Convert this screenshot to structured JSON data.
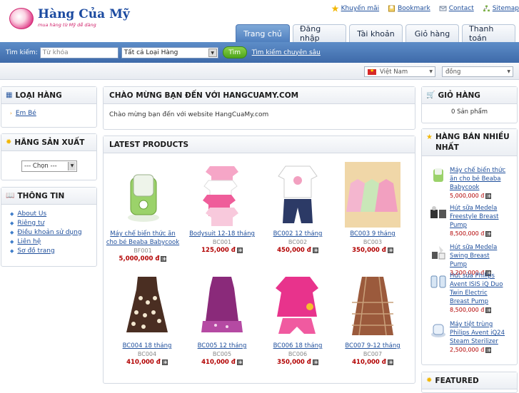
{
  "header": {
    "logo_title": "Hàng Của Mỹ",
    "logo_slogan": "mua hàng từ Mỹ dễ dàng",
    "top_links": [
      {
        "label": "Khuyến mãi",
        "icon": "star-icon"
      },
      {
        "label": "Bookmark",
        "icon": "bookmark-icon"
      },
      {
        "label": "Contact",
        "icon": "mail-icon"
      },
      {
        "label": "Sitemap",
        "icon": "sitemap-icon"
      }
    ],
    "tabs": [
      "Trang chủ",
      "Đăng nhập",
      "Tài khoản",
      "Giỏ hàng",
      "Thanh toán"
    ],
    "active_tab": "Trang chủ"
  },
  "search": {
    "label": "Tìm kiếm:",
    "placeholder": "Từ khóa",
    "category": "Tất cả Loại Hàng",
    "button": "Tìm",
    "advanced": "Tìm kiếm chuyên sâu"
  },
  "lang": {
    "language": "Việt Nam",
    "currency": "đồng"
  },
  "left": {
    "categories_title": "LOẠI HÀNG",
    "categories": [
      "Em Bé"
    ],
    "manufacturers_title": "HÃNG SẢN XUẤT",
    "manufacturer_select": "--- Chọn ---",
    "info_title": "THÔNG TIN",
    "info_links": [
      "About Us",
      "Riêng tư",
      "Điều khoản sử dụng",
      "Liên hệ",
      "Sơ đồ trang"
    ]
  },
  "center": {
    "welcome_title": "CHÀO MỪNG BẠN ĐẾN VỚI HANGCUAMY.COM",
    "welcome_text": "Chào mừng bạn đến với website HangCuaMy.com",
    "latest_title": "LATEST PRODUCTS",
    "products": [
      {
        "name": "Máy chế biến thức ăn cho bé Beaba Babycook",
        "code": "BF001",
        "price": "5,000,000 đ"
      },
      {
        "name": "Bodysuit 12-18 tháng",
        "code": "BC001",
        "price": "125,000 đ"
      },
      {
        "name": "BC002 12 tháng",
        "code": "BC002",
        "price": "450,000 đ"
      },
      {
        "name": "BC003 9 tháng",
        "code": "BC003",
        "price": "350,000 đ"
      },
      {
        "name": "BC004 18 tháng",
        "code": "BC004",
        "price": "410,000 đ"
      },
      {
        "name": "BC005 12 tháng",
        "code": "BC005",
        "price": "410,000 đ"
      },
      {
        "name": "BC006 18 tháng",
        "code": "BC006",
        "price": "350,000 đ"
      },
      {
        "name": "BC007 9-12 tháng",
        "code": "BC007",
        "price": "410,000 đ"
      }
    ]
  },
  "right": {
    "cart_title": "GIỎ HÀNG",
    "cart_text": "0 Sản phẩm",
    "bestsellers_title": "HÀNG BÁN NHIỀU NHẤT",
    "bestsellers": [
      {
        "name": "Máy chế biến thức ăn cho bé Beaba Babycook",
        "price": "5,000,000 đ"
      },
      {
        "name": "Hút sữa Medela Freestyle Breast Pump",
        "price": "8,500,000 đ"
      },
      {
        "name": "Hút sữa Medela Swing Breast Pump",
        "price": "3,200,000 đ"
      },
      {
        "name": "Hút sữa Philips Avent ISIS iQ Duo Twin Electric Breast Pump",
        "price": "8,500,000 đ"
      },
      {
        "name": "Máy tiệt trùng Philips Avent iQ24 Steam Sterilizer",
        "price": "2,500,000 đ"
      }
    ],
    "featured_title": "FEATURED"
  }
}
